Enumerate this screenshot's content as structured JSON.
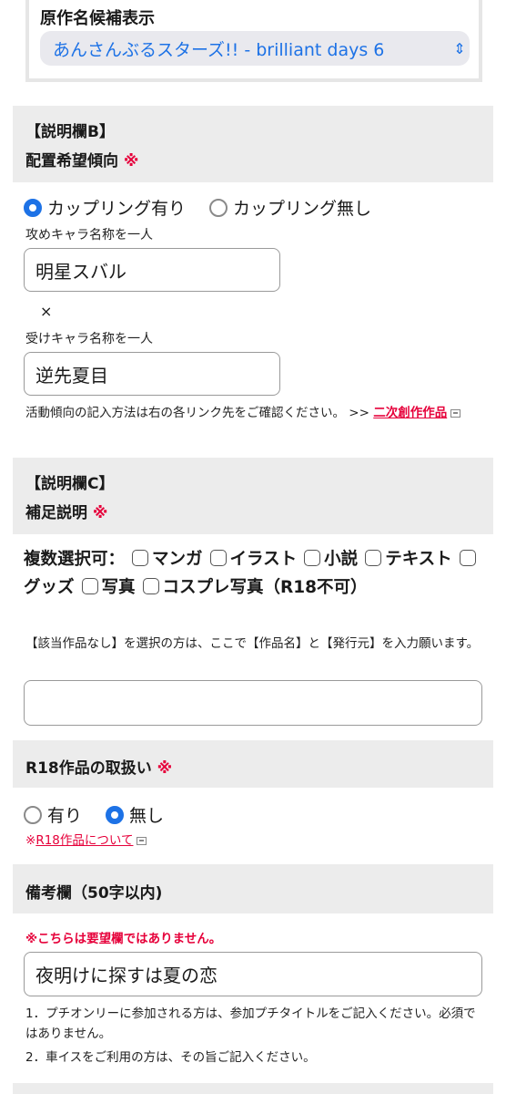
{
  "source_title": {
    "label": "原作名候補表示",
    "selected": "あんさんぶるスターズ!! - brilliant days 6"
  },
  "section_b": {
    "header": "【説明欄B】",
    "title": "配置希望傾向",
    "required_mark": "※",
    "radio_coupling_yes": "カップリング有り",
    "radio_coupling_no": "カップリング無し",
    "seme_label": "攻めキャラ名称を一人",
    "seme_value": "明星スバル",
    "times": "×",
    "uke_label": "受けキャラ名称を一人",
    "uke_value": "逆先夏目",
    "note_text": "活動傾向の記入方法は右の各リンク先をご確認ください。 >> ",
    "note_link": "二次創作作品"
  },
  "section_c": {
    "header": "【説明欄C】",
    "title": "補足説明",
    "required_mark": "※",
    "multi_label": "複数選択可：",
    "options": [
      "マンガ",
      "イラスト",
      "小説",
      "テキスト",
      "グッズ",
      "写真",
      "コスプレ写真（R18不可）"
    ],
    "note": "【該当作品なし】を選択の方は、ここで【作品名】と【発行元】を入力願います。",
    "input_value": ""
  },
  "r18": {
    "title": "R18作品の取扱い",
    "required_mark": "※",
    "yes": "有り",
    "no": "無し",
    "link_prefix": "※",
    "link": "R18作品について"
  },
  "remarks": {
    "title": "備考欄（50字以内)",
    "warning": "※こちらは要望欄ではありません。",
    "value": "夜明けに探すは夏の恋",
    "note1": "1．プチオンリーに参加される方は、参加プチタイトルをご記入ください。必須ではありません。",
    "note2": "2．車イスをご利用の方は、その旨ご記入ください。"
  },
  "colors": {
    "accent": "#1d72e6",
    "required": "#e6003a",
    "band": "#ececec"
  }
}
